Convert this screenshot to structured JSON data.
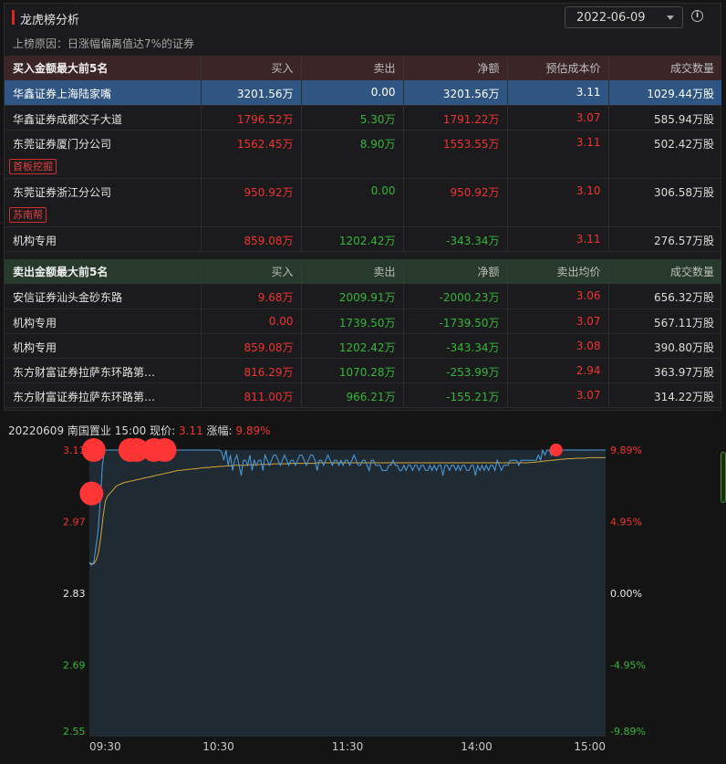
{
  "header": {
    "title": "龙虎榜分析",
    "date": "2022-06-09",
    "info_icon": "info-icon",
    "reason": "上榜原因：日涨幅偏离值达7%的证券"
  },
  "buy_table": {
    "headers": [
      "买入金额最大前5名",
      "买入",
      "卖出",
      "净额",
      "预估成本价",
      "成交数量"
    ],
    "rows": [
      {
        "name": "华鑫证券上海陆家嘴",
        "buy": "3201.56万",
        "sell": "0.00",
        "net": "3201.56万",
        "price": "3.11",
        "volume": "1029.44万股",
        "tag": ""
      },
      {
        "name": "华鑫证券成都交子大道",
        "buy": "1796.52万",
        "sell": "5.30万",
        "net": "1791.22万",
        "price": "3.07",
        "volume": "585.94万股",
        "tag": ""
      },
      {
        "name": "东莞证券厦门分公司",
        "buy": "1562.45万",
        "sell": "8.90万",
        "net": "1553.55万",
        "price": "3.11",
        "volume": "502.42万股",
        "tag": "首板挖掘"
      },
      {
        "name": "东莞证券浙江分公司",
        "buy": "950.92万",
        "sell": "0.00",
        "net": "950.92万",
        "price": "3.10",
        "volume": "306.58万股",
        "tag": "苏南帮"
      },
      {
        "name": "机构专用",
        "buy": "859.08万",
        "sell": "1202.42万",
        "net": "-343.34万",
        "price": "3.11",
        "volume": "276.57万股",
        "tag": ""
      }
    ]
  },
  "sell_table": {
    "headers": [
      "卖出金额最大前5名",
      "买入",
      "卖出",
      "净额",
      "卖出均价",
      "成交数量"
    ],
    "rows": [
      {
        "name": "安信证券汕头金砂东路",
        "buy": "9.68万",
        "sell": "2009.91万",
        "net": "-2000.23万",
        "price": "3.06",
        "volume": "656.32万股"
      },
      {
        "name": "机构专用",
        "buy": "0.00",
        "sell": "1739.50万",
        "net": "-1739.50万",
        "price": "3.07",
        "volume": "567.11万股"
      },
      {
        "name": "机构专用",
        "buy": "859.08万",
        "sell": "1202.42万",
        "net": "-343.34万",
        "price": "3.08",
        "volume": "390.80万股"
      },
      {
        "name": "东方财富证券拉萨东环路第…",
        "buy": "816.29万",
        "sell": "1070.28万",
        "net": "-253.99万",
        "price": "2.94",
        "volume": "363.97万股"
      },
      {
        "name": "东方财富证券拉萨东环路第…",
        "buy": "811.00万",
        "sell": "966.21万",
        "net": "-155.21万",
        "price": "3.07",
        "volume": "314.22万股"
      }
    ]
  },
  "chart_header": {
    "text": "20220609 南国置业 15:00 现价:",
    "price": "3.11",
    "change_label": "涨幅:",
    "change": "9.89%"
  },
  "chart_data": {
    "type": "line",
    "title": "",
    "xlabel": "",
    "ylabel": "",
    "y_ticks_left": [
      "3.11",
      "2.97",
      "2.83",
      "2.69",
      "2.55"
    ],
    "y_ticks_right": [
      "9.89%",
      "4.95%",
      "0.00%",
      "-4.95%",
      "-9.89%"
    ],
    "x_ticks": [
      "09:30",
      "10:30",
      "11:30",
      "14:00",
      "15:00"
    ],
    "ylim": [
      2.55,
      3.11
    ],
    "prev_close": 2.83,
    "colors": {
      "price": "#4d9fe0",
      "avg": "#d6a23a",
      "up": "#f03333",
      "down": "#35b63a",
      "marker": "#ff3535"
    },
    "series": [
      {
        "values": [
          2.89,
          2.885,
          2.89,
          2.92,
          2.95,
          3.01,
          3.08,
          3.11,
          3.11,
          3.11,
          3.11,
          3.11,
          3.11,
          3.11,
          3.11,
          3.11,
          3.11,
          3.11,
          3.11,
          3.11,
          3.11,
          3.11,
          3.11,
          3.11,
          3.11,
          3.11,
          3.11,
          3.11,
          3.11,
          3.11,
          3.11,
          3.11,
          3.11,
          3.11,
          3.11,
          3.11,
          3.11,
          3.11,
          3.11,
          3.11,
          3.11,
          3.11,
          3.11,
          3.11,
          3.11,
          3.11,
          3.11,
          3.11,
          3.11,
          3.11,
          3.11,
          3.11,
          3.11,
          3.11,
          3.11,
          3.11,
          3.11,
          3.11,
          3.11,
          3.11,
          3.11,
          3.105,
          3.09,
          3.11,
          3.08,
          3.1,
          3.07,
          3.09,
          3.1,
          3.08,
          3.06,
          3.09,
          3.09,
          3.08,
          3.1,
          3.07,
          3.09,
          3.08,
          3.09,
          3.09,
          3.07,
          3.1,
          3.09,
          3.08,
          3.09,
          3.1,
          3.1,
          3.09,
          3.08,
          3.09,
          3.1,
          3.09,
          3.08,
          3.09,
          3.09,
          3.08,
          3.09,
          3.1,
          3.1,
          3.09,
          3.08,
          3.09,
          3.1,
          3.1,
          3.09,
          3.07,
          3.09,
          3.09,
          3.08,
          3.09,
          3.1,
          3.09,
          3.08,
          3.09,
          3.09,
          3.08,
          3.09,
          3.08,
          3.09,
          3.09,
          3.08,
          3.09,
          3.1,
          3.09,
          3.08,
          3.08,
          3.09,
          3.09,
          3.08,
          3.07,
          3.09,
          3.09,
          3.08,
          3.08,
          3.08,
          3.07,
          3.07,
          3.07,
          3.08,
          3.08,
          3.09,
          3.08,
          3.08,
          3.07,
          3.07,
          3.08,
          3.07,
          3.08,
          3.08,
          3.07,
          3.08,
          3.08,
          3.07,
          3.08,
          3.08,
          3.07,
          3.07,
          3.08,
          3.07,
          3.08,
          3.07,
          3.08,
          3.08,
          3.06,
          3.08,
          3.08,
          3.07,
          3.08,
          3.08,
          3.07,
          3.08,
          3.07,
          3.08,
          3.08,
          3.07,
          3.07,
          3.08,
          3.08,
          3.06,
          3.08,
          3.07,
          3.08,
          3.07,
          3.08,
          3.07,
          3.08,
          3.08,
          3.07,
          3.09,
          3.08,
          3.07,
          3.08,
          3.08,
          3.08,
          3.09,
          3.09,
          3.09,
          3.09,
          3.08,
          3.09,
          3.09,
          3.09,
          3.09,
          3.09,
          3.09,
          3.09,
          3.09,
          3.1,
          3.09,
          3.11,
          3.1,
          3.11,
          3.11,
          3.1,
          3.11,
          3.1,
          3.11,
          3.11,
          3.11,
          3.11,
          3.11,
          3.11,
          3.11,
          3.11,
          3.11,
          3.11,
          3.11,
          3.11,
          3.11,
          3.11,
          3.11,
          3.11,
          3.11,
          3.11,
          3.11,
          3.11,
          3.11,
          3.11,
          3.11
        ]
      },
      {
        "values": [
          2.89,
          2.888,
          2.888,
          2.895,
          2.91,
          2.94,
          2.98,
          3.01,
          3.02,
          3.025,
          3.03,
          3.035,
          3.04,
          3.042,
          3.044,
          3.046,
          3.047,
          3.048,
          3.049,
          3.05,
          3.051,
          3.052,
          3.053,
          3.054,
          3.055,
          3.056,
          3.057,
          3.058,
          3.059,
          3.06,
          3.061,
          3.062,
          3.063,
          3.064,
          3.065,
          3.066,
          3.067,
          3.068,
          3.069,
          3.07,
          3.07,
          3.071,
          3.071,
          3.072,
          3.072,
          3.073,
          3.073,
          3.074,
          3.074,
          3.075,
          3.075,
          3.076,
          3.076,
          3.076,
          3.077,
          3.077,
          3.077,
          3.078,
          3.078,
          3.078,
          3.079,
          3.079,
          3.079,
          3.079,
          3.08,
          3.08,
          3.08,
          3.08,
          3.08,
          3.08,
          3.081,
          3.081,
          3.081,
          3.081,
          3.081,
          3.082,
          3.082,
          3.082,
          3.082,
          3.082,
          3.082,
          3.083,
          3.083,
          3.083,
          3.083,
          3.083,
          3.083,
          3.083,
          3.084,
          3.084,
          3.084,
          3.084,
          3.084,
          3.084,
          3.084,
          3.084,
          3.084,
          3.084,
          3.084,
          3.084,
          3.085,
          3.085,
          3.085,
          3.085,
          3.085,
          3.085,
          3.085,
          3.085,
          3.085,
          3.085,
          3.085,
          3.085,
          3.085,
          3.085,
          3.085,
          3.085,
          3.085,
          3.085,
          3.085,
          3.085,
          3.085,
          3.085,
          3.085,
          3.085,
          3.085,
          3.085,
          3.085,
          3.085,
          3.085,
          3.085,
          3.085,
          3.085,
          3.085,
          3.085,
          3.085,
          3.085,
          3.085,
          3.085,
          3.085,
          3.085,
          3.085,
          3.085,
          3.085,
          3.085,
          3.085,
          3.085,
          3.085,
          3.085,
          3.085,
          3.085,
          3.085,
          3.085,
          3.085,
          3.085,
          3.085,
          3.085,
          3.085,
          3.085,
          3.085,
          3.085,
          3.085,
          3.085,
          3.085,
          3.085,
          3.085,
          3.085,
          3.085,
          3.085,
          3.085,
          3.085,
          3.085,
          3.085,
          3.085,
          3.085,
          3.085,
          3.085,
          3.085,
          3.085,
          3.085,
          3.085,
          3.085,
          3.085,
          3.085,
          3.085,
          3.085,
          3.085,
          3.085,
          3.085,
          3.085,
          3.085,
          3.085,
          3.085,
          3.085,
          3.085,
          3.086,
          3.086,
          3.086,
          3.087,
          3.087,
          3.088,
          3.088,
          3.089,
          3.089,
          3.09,
          3.09,
          3.091,
          3.091,
          3.092,
          3.092,
          3.092,
          3.093,
          3.093,
          3.093,
          3.093,
          3.094,
          3.094,
          3.094,
          3.094,
          3.094,
          3.095,
          3.095,
          3.095,
          3.095,
          3.095,
          3.095,
          3.095,
          3.095,
          3.095
        ]
      }
    ],
    "markers": [
      {
        "time": "09:32",
        "value": 3.11,
        "size": "large"
      },
      {
        "time": "09:31",
        "value": 3.025,
        "size": "large"
      },
      {
        "time": "09:49",
        "value": 3.11,
        "size": "large"
      },
      {
        "time": "09:52",
        "value": 3.11,
        "size": "large"
      },
      {
        "time": "10:00",
        "value": 3.11,
        "size": "large"
      },
      {
        "time": "10:05",
        "value": 3.11,
        "size": "large"
      },
      {
        "time": "14:37",
        "value": 3.11,
        "size": "small"
      }
    ]
  }
}
